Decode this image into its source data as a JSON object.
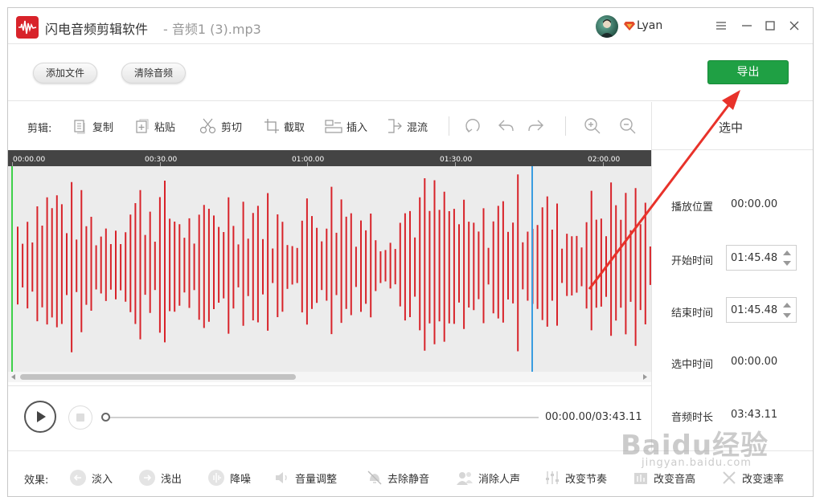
{
  "window": {
    "app_name": "闪电音频剪辑软件",
    "file_title": "- 音频1 (3).mp3",
    "username": "Lyan"
  },
  "toolbar": {
    "add_file": "添加文件",
    "clear_audio": "清除音频",
    "export": "导出"
  },
  "edit": {
    "label": "剪辑:",
    "copy": "复制",
    "paste": "粘贴",
    "cut": "剪切",
    "crop": "截取",
    "insert": "插入",
    "mix": "混流"
  },
  "timeline": {
    "ticks": [
      "00:00.00",
      "00:30.00",
      "01:00.00",
      "01:30.00",
      "02:00.00"
    ]
  },
  "panel": {
    "title": "选中",
    "play_position_label": "播放位置",
    "play_position": "00:00.00",
    "start_label": "开始时间",
    "start": "01:45.48",
    "end_label": "结束时间",
    "end": "01:45.48",
    "selected_label": "选中时间",
    "selected": "00:00.00",
    "duration_label": "音频时长",
    "duration": "03:43.11"
  },
  "player": {
    "time": "00:00.00/03:43.11"
  },
  "effects": {
    "label": "效果:",
    "fade_in": "淡入",
    "fade_out": "浅出",
    "denoise": "降噪",
    "volume": "音量调整",
    "remove_silence": "去除静音",
    "remove_vocal": "消除人声",
    "tempo": "改变节奏",
    "pitch": "改变音高",
    "speed": "改变速率"
  },
  "watermark": {
    "brand": "Baidu经验",
    "url": "jingyan.baidu.com"
  },
  "colors": {
    "accent": "#1fa044",
    "wave": "#d8232a",
    "playhead": "#3a9de0",
    "arrow": "#e8322a"
  }
}
